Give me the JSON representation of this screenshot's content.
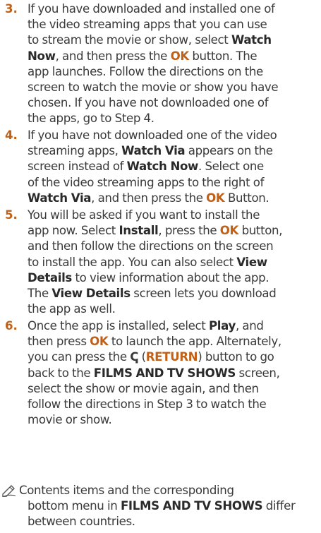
{
  "steps": [
    {
      "number": "3.",
      "lines": [
        [
          "If you have downloaded and installed one of"
        ],
        [
          "the video streaming apps that you can use"
        ],
        [
          "to stream the movie or show, select ",
          {
            "b": "Watch"
          }
        ],
        [
          {
            "b": "Now"
          },
          ", and then press the ",
          {
            "ok": "OK"
          },
          " button. The"
        ],
        [
          "app launches. Follow the directions on the"
        ],
        [
          "screen to watch the movie or show you have"
        ],
        [
          "chosen. If you have not downloaded one of"
        ],
        [
          "the apps, go to Step 4."
        ]
      ]
    },
    {
      "number": "4.",
      "lines": [
        [
          "If you have not downloaded one of the video"
        ],
        [
          "streaming apps, ",
          {
            "b": "Watch Via"
          },
          " appears on the"
        ],
        [
          "screen instead of ",
          {
            "b": "Watch Now"
          },
          ". Select one"
        ],
        [
          "of the video streaming apps to the right of"
        ],
        [
          {
            "b": "Watch Via"
          },
          ", and then press the ",
          {
            "ok": "OK"
          },
          " Button."
        ]
      ]
    },
    {
      "number": "5.",
      "lines": [
        [
          "You will be asked if you want to install the"
        ],
        [
          "app now. Select ",
          {
            "b": "Install"
          },
          ", press the ",
          {
            "ok": "OK"
          },
          " button,"
        ],
        [
          "and then follow the directions on the screen"
        ],
        [
          "to install the app. You can also select ",
          {
            "b": "View"
          }
        ],
        [
          {
            "b": "Details"
          },
          " to view information about the app."
        ],
        [
          "The ",
          {
            "b": "View Details"
          },
          " screen lets you download"
        ],
        [
          "the app as well."
        ]
      ]
    },
    {
      "number": "6.",
      "lines": [
        [
          "Once the app is installed, select ",
          {
            "b": "Play"
          },
          ", and"
        ],
        [
          "then press ",
          {
            "ok": "OK"
          },
          " to launch the app. Alternately,"
        ],
        [
          "you can press the ",
          {
            "icon": "ↅ"
          },
          " (",
          {
            "ok": "RETURN"
          },
          ") button to go"
        ],
        [
          "back to the ",
          {
            "b": "FILMS AND TV SHOWS"
          },
          " screen,"
        ],
        [
          "select the show or movie again, and then"
        ],
        [
          "follow the directions in Step 3 to watch the"
        ],
        [
          "movie or show."
        ]
      ]
    }
  ],
  "note": {
    "icon": "pencil-note-icon",
    "lines": [
      [
        "Contents items and the corresponding"
      ],
      [
        "bottom menu in ",
        {
          "b": "FILMS AND TV SHOWS"
        },
        " differ"
      ],
      [
        "between countries."
      ]
    ]
  },
  "colors": {
    "accent": "#c0611a",
    "text": "#3a3a3a"
  }
}
